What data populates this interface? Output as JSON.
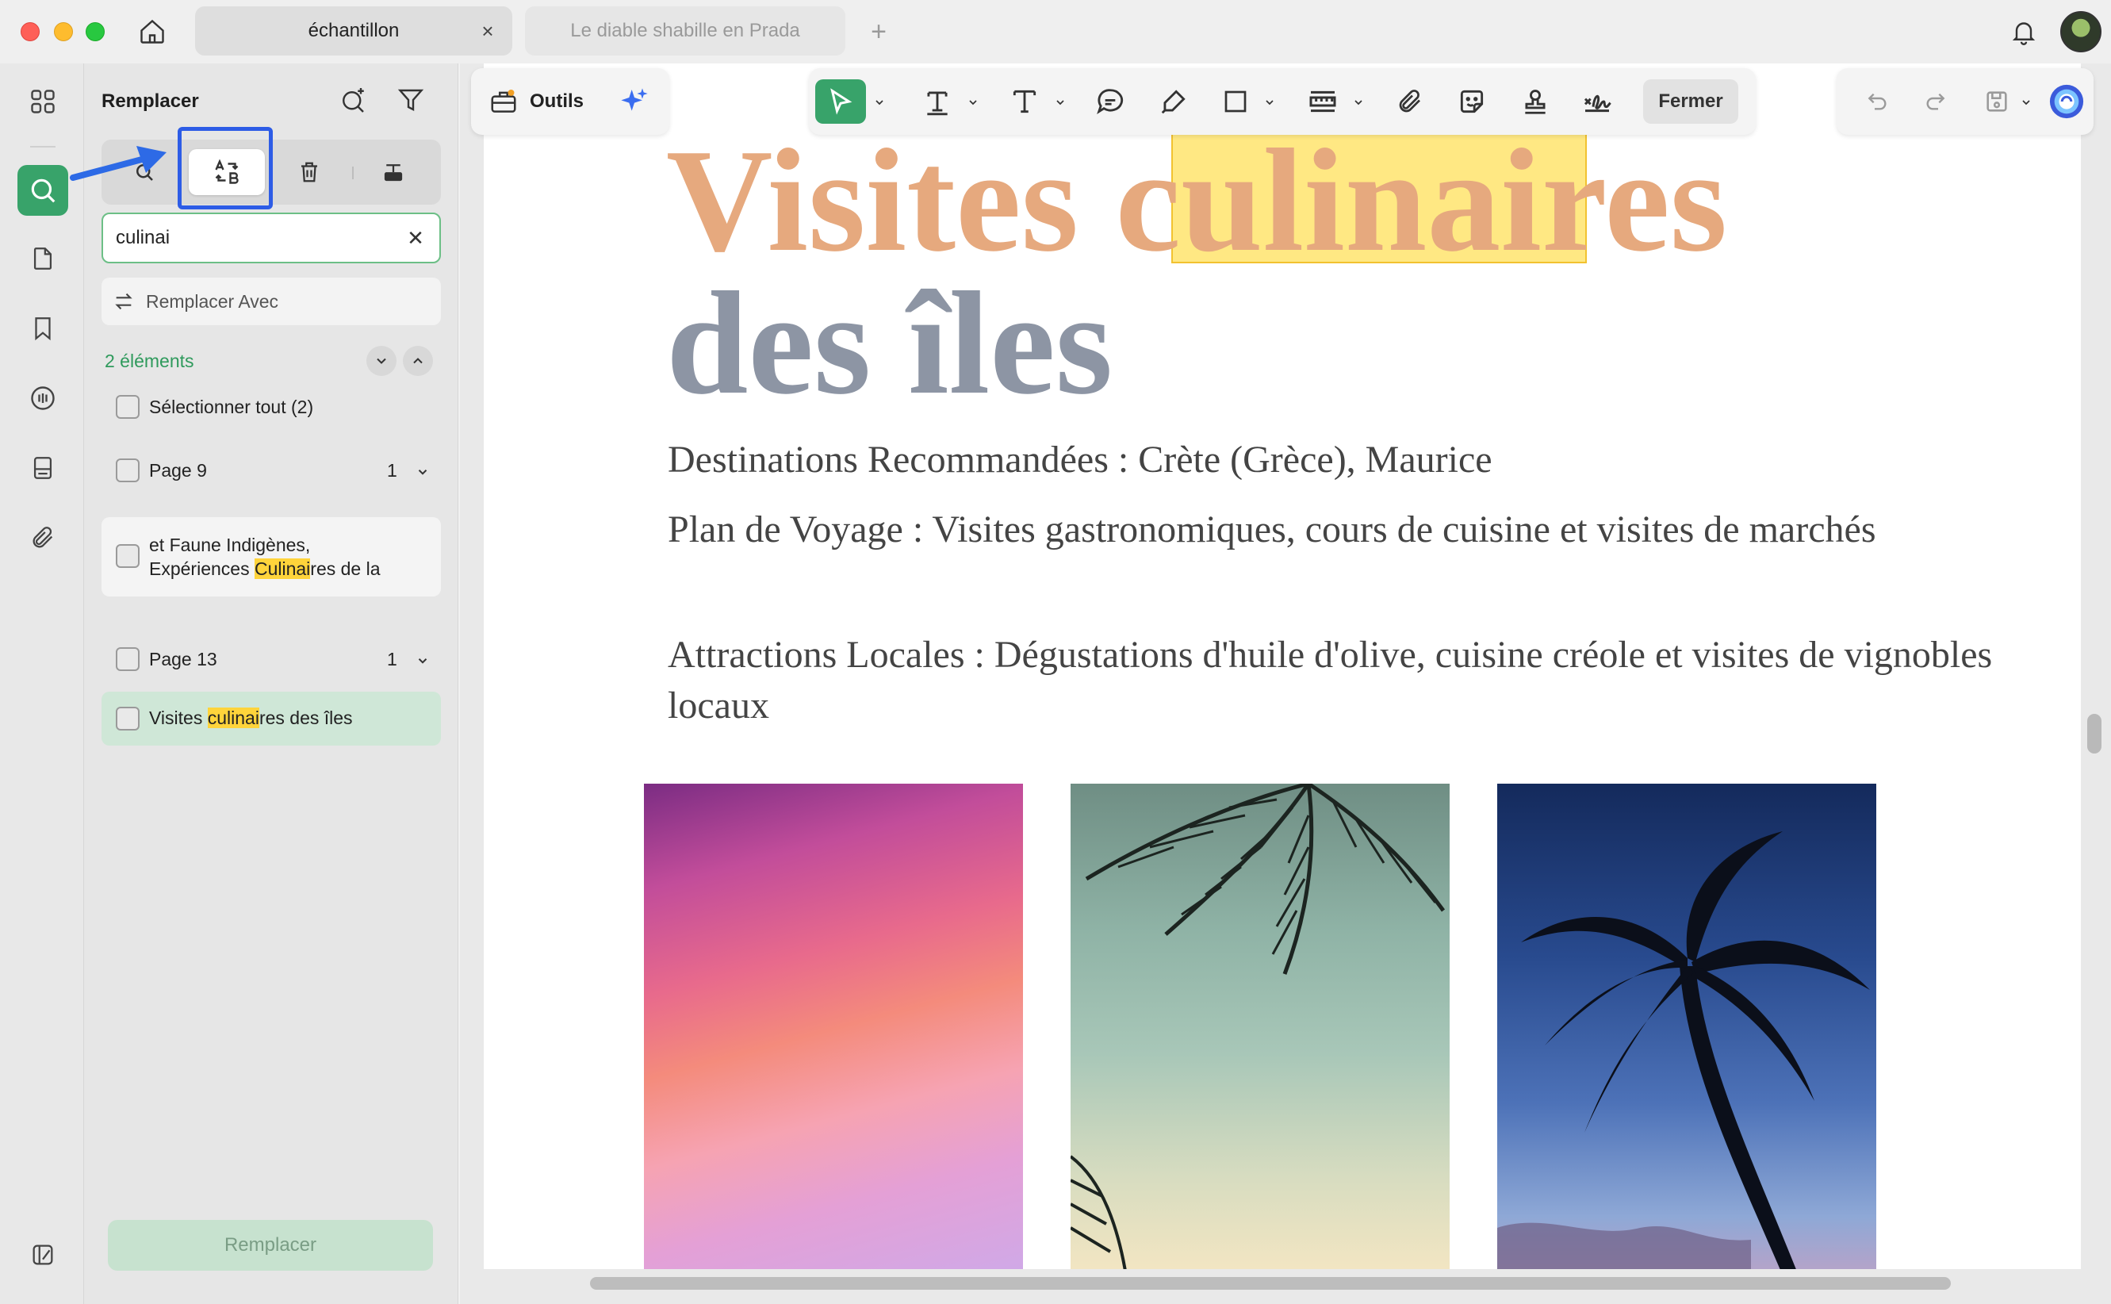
{
  "window": {
    "tabs": [
      {
        "label": "échantillon",
        "active": true
      },
      {
        "label": "Le diable shabille en Prada",
        "active": false
      }
    ],
    "new_tab_label": "+"
  },
  "panel": {
    "title": "Remplacer",
    "search_value": "culinai",
    "replace_placeholder": "Remplacer Avec",
    "results_count": "2 éléments",
    "select_all": "Sélectionner tout  (2)",
    "groups": [
      {
        "page": "Page 9",
        "count": "1",
        "result": {
          "pre": "et Faune Indigènes,",
          "line2_pre": "Expériences ",
          "match": "Culinai",
          "post": "res de la"
        }
      },
      {
        "page": "Page 13",
        "count": "1",
        "result": {
          "pre": "Visites ",
          "match": "culinai",
          "post": "res des îles"
        }
      }
    ],
    "replace_button": "Remplacer"
  },
  "toolbar": {
    "tools_label": "Outils",
    "close_label": "Fermer",
    "accent_color": "#38a36a"
  },
  "document": {
    "heading_line1": "Visites culinaires",
    "heading_line2": "des îles",
    "para1": "Destinations Recommandées : Crète (Grèce), Maurice",
    "para2": "Plan de Voyage : Visites gastronomiques, cours de cuisine et visites de marchés",
    "para3": "Attractions Locales : Dégustations d'huile d'olive, cuisine créole et visites de vignobles locaux"
  }
}
